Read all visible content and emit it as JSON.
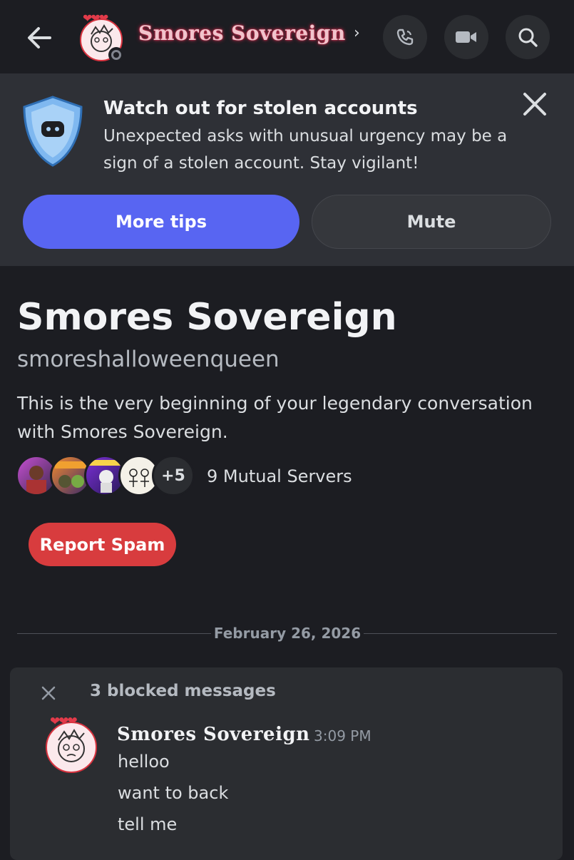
{
  "header": {
    "title": "Smores Sovereign",
    "chevron": "›",
    "icons": [
      "back-arrow-icon",
      "call-icon",
      "video-icon",
      "search-icon"
    ],
    "status": "offline"
  },
  "banner": {
    "title": "Watch out for stolen accounts",
    "body": "Unexpected asks with unusual urgency may be a sign of a stolen account. Stay vigilant!",
    "primary_button": "More tips",
    "secondary_button": "Mute",
    "close_icon": "close-icon"
  },
  "profile": {
    "display_name": "Smores Sovereign",
    "username": "smoreshalloweenqueen",
    "intro": "This is the very beginning of your legendary conversation with Smores Sovereign.",
    "more_servers": "+5",
    "mutual_servers": "9 Mutual Servers",
    "report_button": "Report Spam"
  },
  "divider": {
    "date": "February 26, 2026"
  },
  "blocked": {
    "label": "3 blocked messages",
    "author": "Smores Sovereign",
    "time": "3:09 PM",
    "messages": [
      "helloo",
      "want to back",
      "tell me"
    ]
  },
  "colors": {
    "background": "#1c1d22",
    "banner": "#2e3036",
    "blurple": "#5865f2",
    "danger": "#d83c3e"
  }
}
